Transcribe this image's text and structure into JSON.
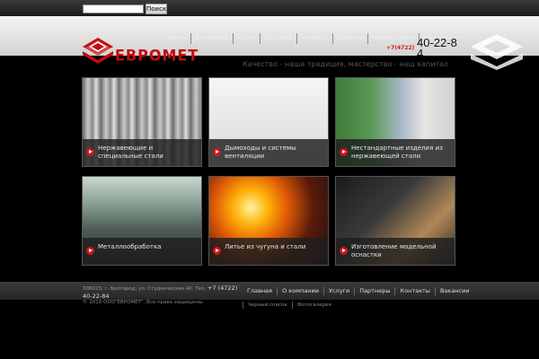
{
  "search": {
    "button_label": "Поиск",
    "value": ""
  },
  "top_nav": [
    "Главная",
    "О компании",
    "Услуги",
    "Партнеры",
    "Контакты",
    "Вакансии",
    "Черный список",
    "Фотогалерея"
  ],
  "logo": {
    "text_part1": "ЕВРО",
    "text_part2": "МЕТ"
  },
  "phone": {
    "code": "+7(4722)",
    "number": "40-22-84"
  },
  "slogan": "Качество - наша традиция, мастерство - наш капитал",
  "tiles": [
    {
      "label": "Нержавеющие и специальные стали"
    },
    {
      "label": "Дымоходы и системы вентиляции"
    },
    {
      "label": "Нестандартные изделия из нержавеющей стали"
    },
    {
      "label": "Металлообработка"
    },
    {
      "label": "Литье из чугуна и стали"
    },
    {
      "label": "Изготовление модельной оснастки"
    }
  ],
  "footer": {
    "address": "308023, г. Белгород, ул. Студенческая 40. Тел.",
    "phone": "+7 (4722) 40-22-84",
    "copyright": "© 2010 ООО\"ЕВРОМЕТ\". Все права защищены.",
    "nav": [
      "Главная",
      "О компании",
      "Услуги",
      "Партнеры",
      "Контакты",
      "Вакансии"
    ],
    "nav2": [
      "Черный список",
      "Фотогалерея"
    ]
  },
  "colors": {
    "brand_red": "#c60b0b",
    "background": "#000000"
  }
}
